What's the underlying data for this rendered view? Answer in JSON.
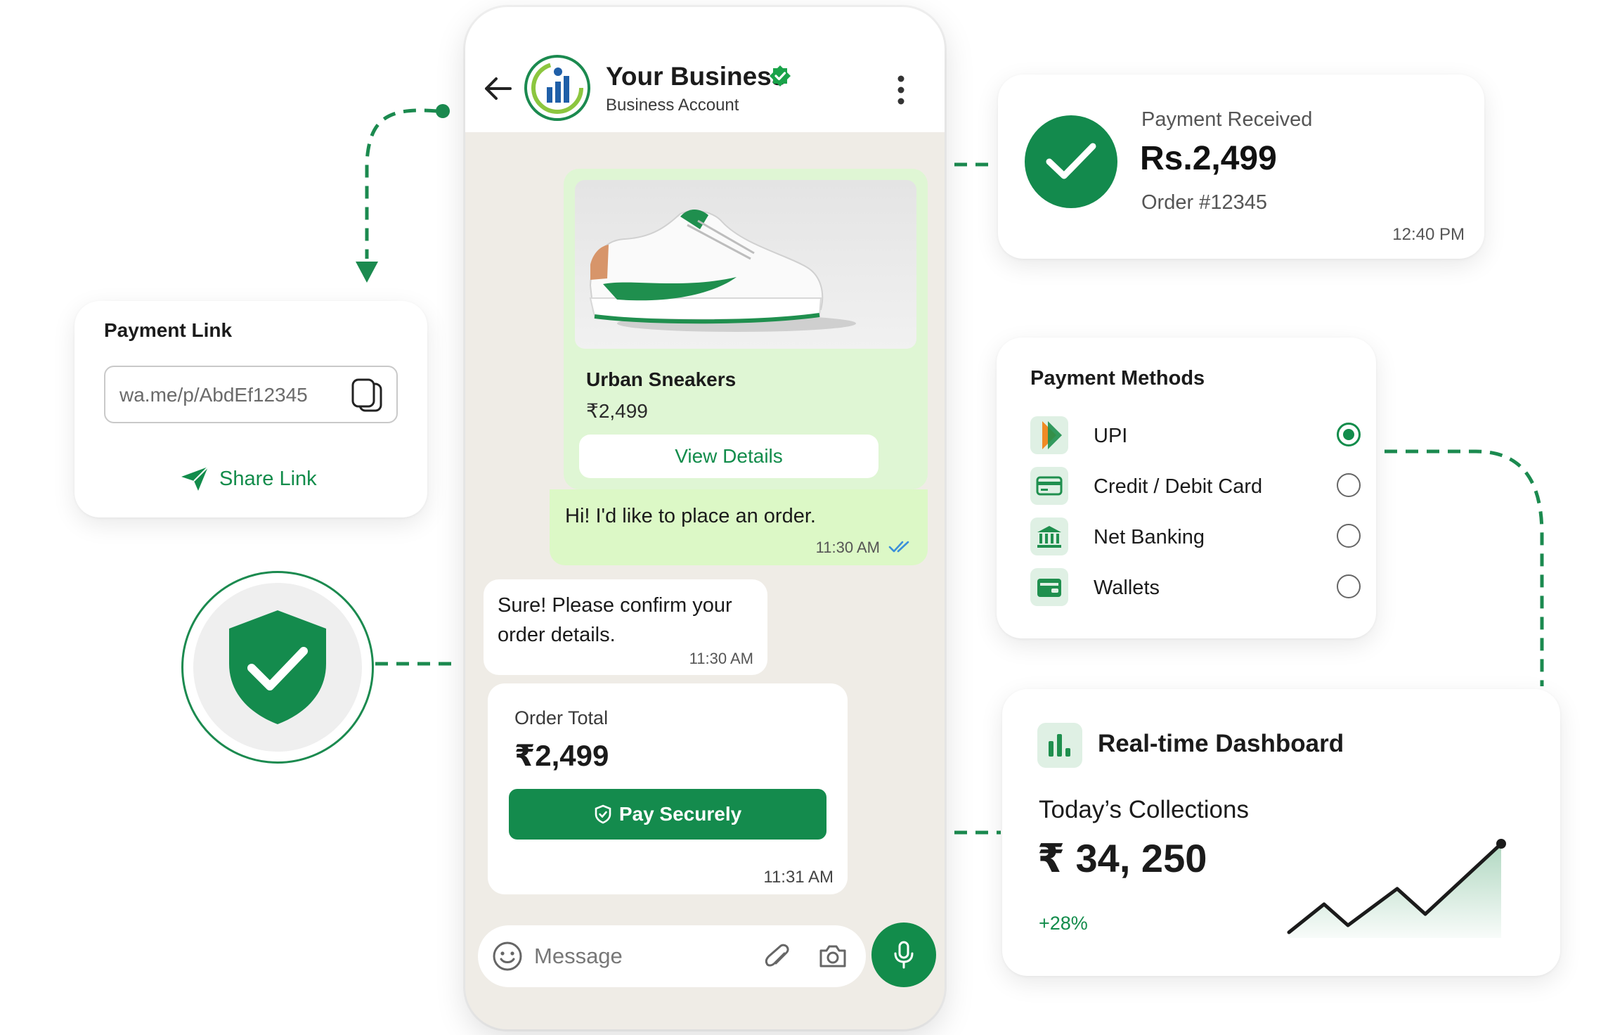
{
  "colors": {
    "accent": "#128c4b",
    "bubble_in": "#dcf8c6",
    "chat_bg": "#efece6"
  },
  "header": {
    "business_name": "Your Business",
    "business_subtitle": "Business Account",
    "icons": [
      "back-arrow-icon",
      "business-logo",
      "verified-badge-icon",
      "more-vert-icon"
    ]
  },
  "chat": {
    "product": {
      "name": "Urban Sneakers",
      "price": "₹2,499",
      "button": "View Details"
    },
    "outgoing": {
      "text": "Hi! I'd like to place an order.",
      "time": "11:30 AM"
    },
    "incoming": {
      "text": "Sure! Please confirm your order details.",
      "time": "11:30 AM"
    },
    "order_total": {
      "label": "Order Total",
      "amount": "₹2,499",
      "button": "Pay Securely",
      "time": "11:31 AM"
    },
    "composer": {
      "placeholder": "Message"
    }
  },
  "payment_link": {
    "title": "Payment Link",
    "value": "wa.me/p/AbdEf12345",
    "share_label": "Share Link"
  },
  "payment_received": {
    "label": "Payment Received",
    "amount": "Rs.2,499",
    "order": "Order #12345",
    "time": "12:40 PM"
  },
  "payment_methods": {
    "title": "Payment Methods",
    "items": [
      {
        "label": "UPI",
        "icon": "upi-icon",
        "selected": true
      },
      {
        "label": "Credit / Debit Card",
        "icon": "card-icon",
        "selected": false
      },
      {
        "label": "Net Banking",
        "icon": "bank-icon",
        "selected": false
      },
      {
        "label": "Wallets",
        "icon": "wallet-icon",
        "selected": false
      }
    ]
  },
  "dashboard": {
    "title": "Real-time Dashboard",
    "subtitle": "Today’s Collections",
    "amount": "₹ 34, 250",
    "growth": "+28%"
  }
}
